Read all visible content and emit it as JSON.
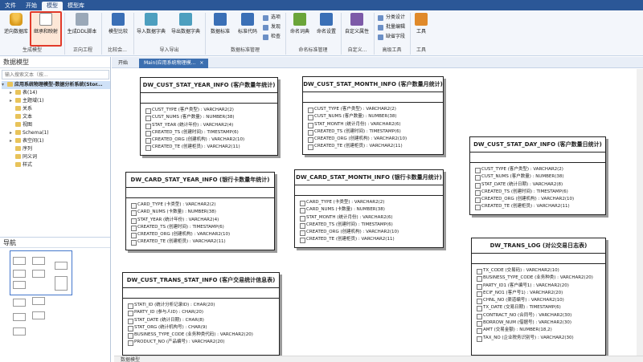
{
  "menu": {
    "tabs": [
      {
        "label": "文件",
        "active": false
      },
      {
        "label": "开始",
        "active": false
      },
      {
        "label": "模型",
        "active": true
      },
      {
        "label": "模型库",
        "active": false
      }
    ]
  },
  "ribbon": {
    "buttons": {
      "reverse_db": "逆向数据库",
      "inherit": "继承和映射",
      "gen_ddl": "生成DDL脚本",
      "model_compare": "模型比较",
      "import_dict": "导入数据字典",
      "export_dict": "导出数据字典",
      "data_std": "数据标准",
      "std_code": "标准代码",
      "dict": "命名词典",
      "name_settings": "命名设置",
      "custom_attr": "自定义属性",
      "tools": "工具"
    },
    "small_buttons": {
      "options": "选项",
      "publish": "发现",
      "check": "检查",
      "classify": "分类设计",
      "batch_edit": "批量编辑",
      "missing_fields": "缺省字段"
    },
    "groups": {
      "gen_model": "生成模型",
      "forward": "正向工程",
      "compare": "比较会...",
      "import_export": "导入导出",
      "data_std_mgmt": "数据标准管理",
      "naming_mgmt": "命名标准管理",
      "custom": "自定义...",
      "advanced": "高级工具",
      "tools": "工具"
    }
  },
  "left_panel": {
    "title": "数据模型",
    "search_placeholder": "输入搜索文本（按...",
    "tree": [
      {
        "label": "应用系统物理模型-数据分析系统(Stor...",
        "level": 0,
        "expander": "▾",
        "root": true
      },
      {
        "label": "表(14)",
        "level": 1,
        "expander": "▸"
      },
      {
        "label": "主题域(1)",
        "level": 1,
        "expander": "▸"
      },
      {
        "label": "关系",
        "level": 1,
        "expander": ""
      },
      {
        "label": "文本",
        "level": 1,
        "expander": ""
      },
      {
        "label": "视图",
        "level": 1,
        "expander": ""
      },
      {
        "label": "Schema(1)",
        "level": 1,
        "expander": "▸"
      },
      {
        "label": "表空间(1)",
        "level": 1,
        "expander": "▸"
      },
      {
        "label": "序列",
        "level": 1,
        "expander": ""
      },
      {
        "label": "同义词",
        "level": 1,
        "expander": ""
      },
      {
        "label": "样式",
        "level": 1,
        "expander": ""
      }
    ],
    "nav_title": "导航"
  },
  "doc_tabs": [
    {
      "label": "开始",
      "active": false
    },
    {
      "label": "Main(应用系统物理模...",
      "active": true
    }
  ],
  "entities": [
    {
      "name": "DW_CUST_STAT_YEAR_INFO (客户数量年统计)",
      "attrs": [
        "CUST_TYPE (客户类型) : VARCHAR2(2)",
        "CUST_NUMS (客户数量) : NUMBER(38)",
        "STAT_YEAR (统计年份) : VARCHAR2(4)",
        "CREATED_TS (创建时间) : TIMESTAMP(6)",
        "CREATED_ORG (创建机构) : VARCHAR2(10)",
        "CREATED_TE (创建柜员) : VARCHAR2(11)"
      ]
    },
    {
      "name": "DW_CUST_STAT_MONTH_INFO (客户数量月统计)",
      "attrs": [
        "CUST_TYPE (客户类型) : VARCHAR2(2)",
        "CUST_NUMS (客户数量) : NUMBER(38)",
        "STAT_MONTH (统计月份) : VARCHAR2(6)",
        "CREATED_TS (创建时间) : TIMESTAMP(6)",
        "CREATED_ORG (创建机构) : VARCHAR2(10)",
        "CREATED_TE (创建柜员) : VARCHAR2(11)"
      ]
    },
    {
      "name": "DW_CUST_STAT_DAY_INFO (客户数量日统计)",
      "attrs": [
        "CUST_TYPE (客户类型) : VARCHAR2(2)",
        "CUST_NUMS (客户数量) : NUMBER(38)",
        "STAT_DATE (统计日期) : VARCHAR2(8)",
        "CREATED_TS (创建时间) : TIMESTAMP(6)",
        "CREATED_ORG (创建机构) : VARCHAR2(10)",
        "CREATED_TE (创建柜员) : VARCHAR2(11)"
      ]
    },
    {
      "name": "DW_CARD_STAT_YEAR_INFO (银行卡数量年统计)",
      "attrs": [
        "CARD_TYPE (卡类型) : VARCHAR2(2)",
        "CARD_NUMS (卡数量) : NUMBER(38)",
        "STAT_YEAR (统计年份) : VARCHAR2(4)",
        "CREATED_TS (创建时间) : TIMESTAMP(6)",
        "CREATED_ORG (创建机构) : VARCHAR2(10)",
        "CREATED_TE (创建柜员) : VARCHAR2(11)"
      ]
    },
    {
      "name": "DW_CARD_STAT_MONTH_INFO (银行卡数量月统计)",
      "attrs": [
        "CARD_TYPE (卡类型) : VARCHAR2(2)",
        "CARD_NUMS (卡数量) : NUMBER(38)",
        "STAT_MONTH (统计月份) : VARCHAR2(6)",
        "CREATED_TS (创建时间) : TIMESTAMP(6)",
        "CREATED_ORG (创建机构) : VARCHAR2(10)",
        "CREATED_TE (创建柜员) : VARCHAR2(11)"
      ]
    },
    {
      "name": "DW_CUST_TRANS_STAT_INFO (客户交易统计信息表)",
      "attrs": [
        "STATI_ID (统计分析记录ID) : CHAR(20)",
        "PARTY_ID (参与人ID) : CHAR(20)",
        "STAT_DATE (统计日期) : CHAR(8)",
        "STAT_ORG (统计机构号) : CHAR(9)",
        "BUSINESS_TYPE_CODE (业务种类代码) : VARCHAR2(20)",
        "PRODUCT_NO (产品编号) : VARCHAR2(20)"
      ]
    },
    {
      "name": "DW_TRANS_LOG (对公交易日志表)",
      "attrs": [
        "TX_CODE (交易码) : VARCHAR2(10)",
        "BUSINESS_TYPE_CODE (业务种类) : VARCHAR2(20)",
        "PARTY_ID1 (客户编号1) : VARCHAR2(20)",
        "ECIF_NO1 (客户号1) : VARCHAR2(20)",
        "CHNL_NO (渠道编号) : VARCHAR2(10)",
        "TX_DATE (交易日期) : TIMESTAMP(6)",
        "CONTRACT_NO (合同号) : VARCHAR2(30)",
        "BORROW_NUM (借据号) : VARCHAR2(30)",
        "AMT (交易金额) : NUMBER(18,2)",
        "TAX_NO (企业税务识别号) : VARCHAR2(30)"
      ]
    }
  ],
  "status": {
    "text": "数据模型"
  },
  "colors": {
    "menubar": "#2b5797",
    "ribbon_bg": "#f3f6fb",
    "highlight_border": "#e23a2a",
    "active_tab": "#3c6fb0"
  }
}
